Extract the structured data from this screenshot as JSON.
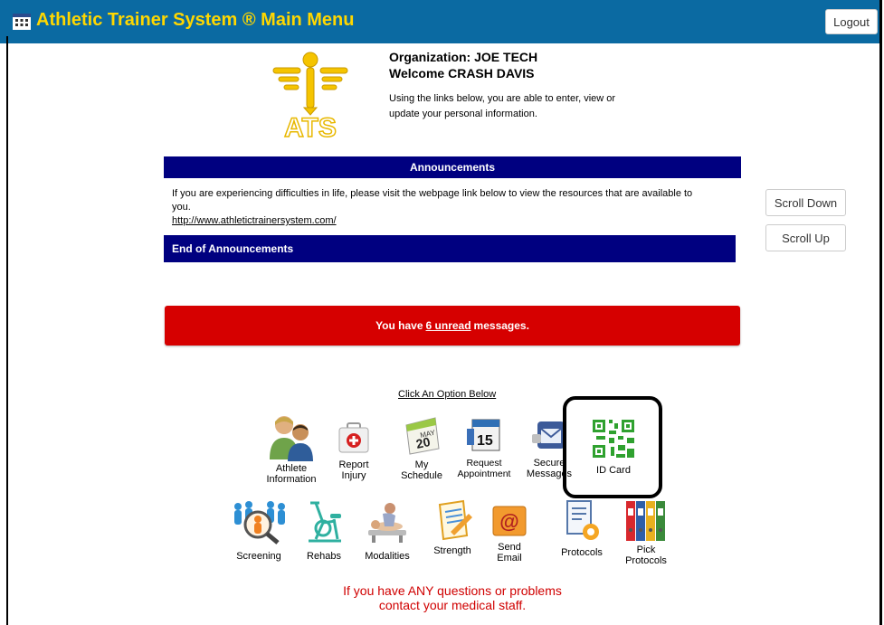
{
  "header": {
    "title": "Athletic Trainer System ® Main Menu",
    "logout_label": "Logout",
    "bar_color": "#0b6aa2",
    "title_color": "#ffd700"
  },
  "info": {
    "logo_text": "ATS",
    "organization": "Organization: JOE TECH",
    "welcome": "Welcome CRASH DAVIS",
    "intro": "Using the links below, you are able to enter, view or update your personal information."
  },
  "announcements": {
    "header": "Announcements",
    "text": "If you are experiencing difficulties in life, please visit the webpage link below to view the resources that are available to you.",
    "link": "http://www.athletictrainersystem.com/",
    "end_label": "End of Announcements"
  },
  "scroll": {
    "down_label": "Scroll Down",
    "up_label": "Scroll Up"
  },
  "messages": {
    "prefix": "You have",
    "count_link": "6 unread",
    "suffix": "messages."
  },
  "options": {
    "prompt": "Click An Option Below",
    "row1": [
      {
        "icon": "athlete-info-icon",
        "label": "Athlete Information"
      },
      {
        "icon": "report-injury-icon",
        "label": "Report Injury"
      },
      {
        "icon": "calendar-icon",
        "label": "My Schedule"
      },
      {
        "icon": "appointment-calendar-icon",
        "label": "Request Appointment"
      },
      {
        "icon": "secure-mail-icon",
        "label": "Secure Messages"
      },
      {
        "icon": "qr-code-icon",
        "label": "ID Card"
      }
    ],
    "row2": [
      {
        "icon": "screening-icon",
        "label": "Screening"
      },
      {
        "icon": "rehab-bike-icon",
        "label": "Rehabs"
      },
      {
        "icon": "modalities-icon",
        "label": "Modalities"
      },
      {
        "icon": "strength-icon",
        "label": "Strength"
      },
      {
        "icon": "email-icon",
        "label": "Send Email"
      },
      {
        "icon": "protocols-icon",
        "label": "Protocols"
      },
      {
        "icon": "binders-icon",
        "label": "Pick Protocols"
      }
    ]
  },
  "calendar_day": "20",
  "calendar_month": "MAY",
  "appointment_day": "15",
  "footer": {
    "line1": "If you have ANY questions or problems",
    "line2": "contact your medical staff."
  }
}
